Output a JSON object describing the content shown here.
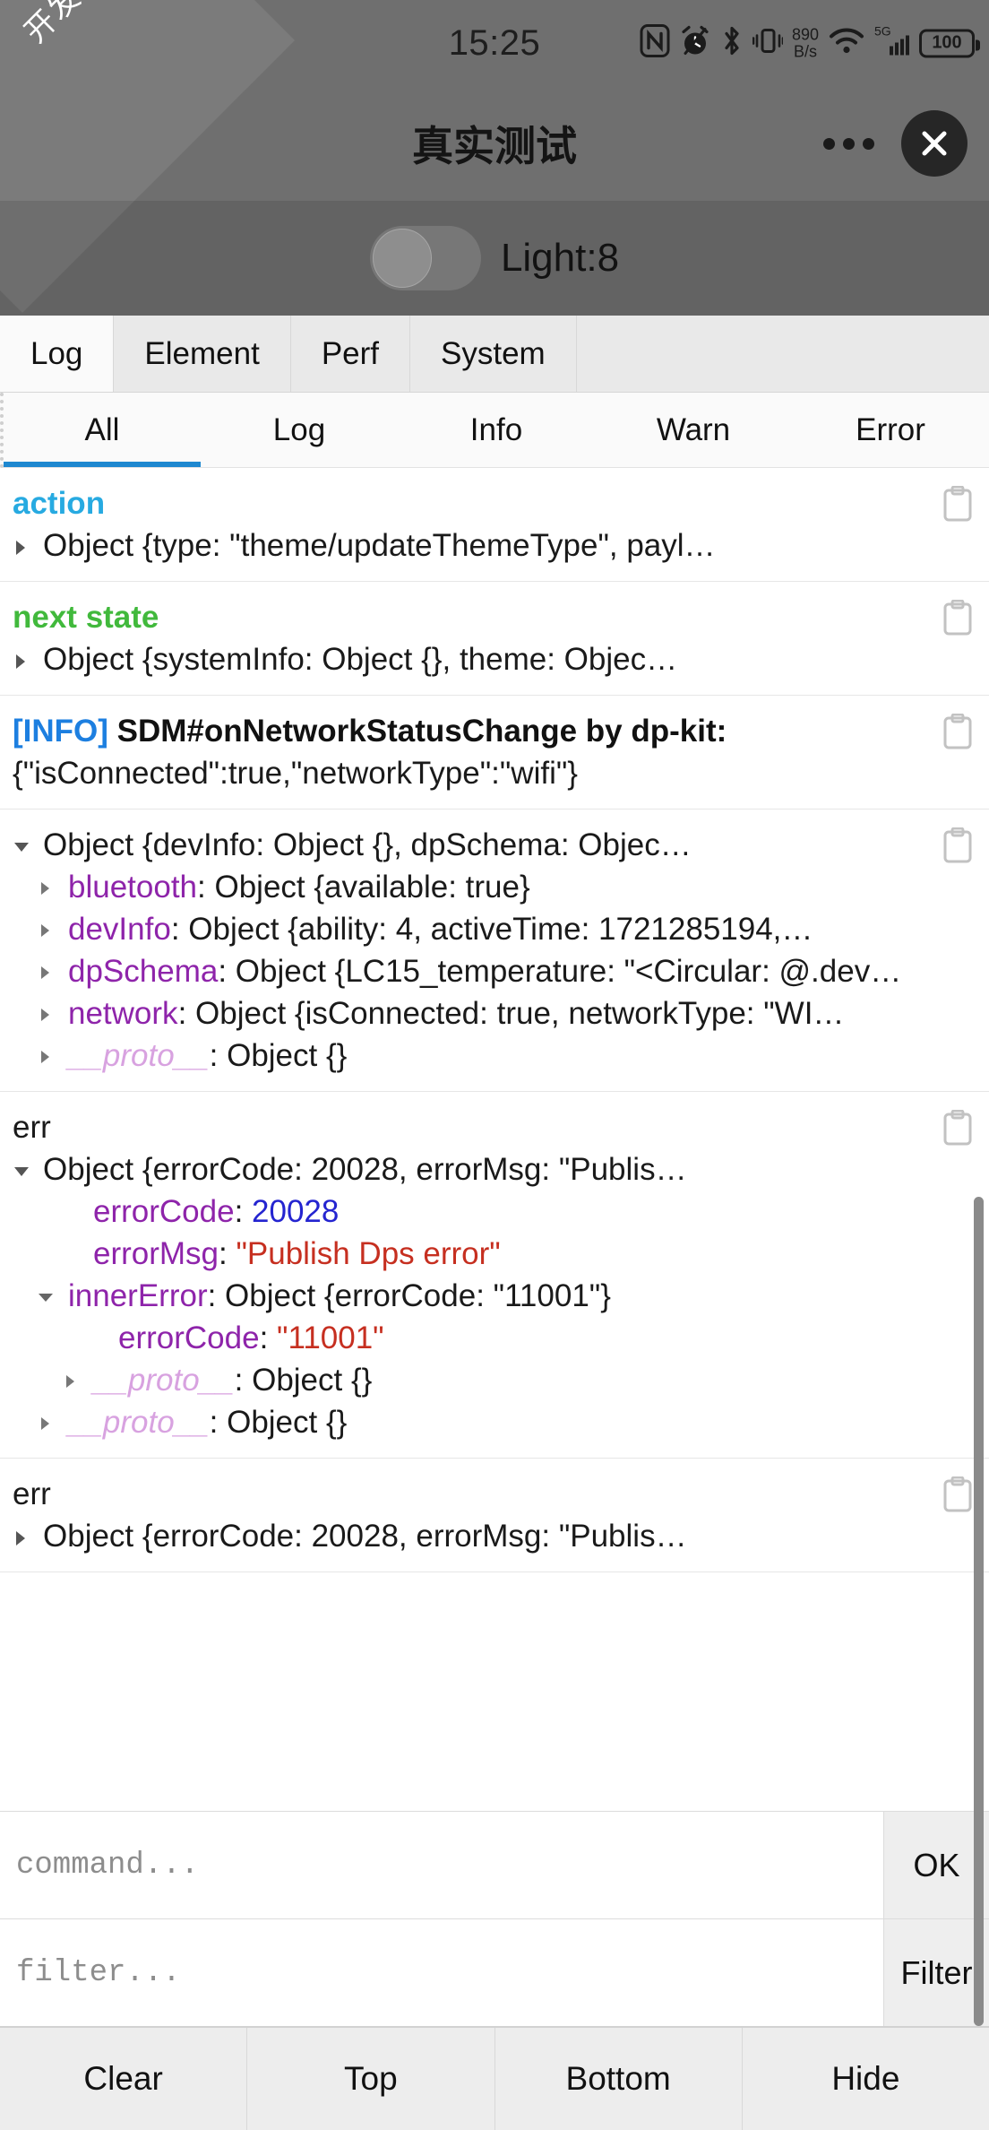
{
  "status_bar": {
    "clock": "15:25",
    "net_speed_value": "890",
    "net_speed_unit": "B/s",
    "cellular_label": "5G",
    "battery_level": "100",
    "icons": [
      "nfc-icon",
      "alarm-muted-icon",
      "bluetooth-icon",
      "vibrate-icon",
      "network-speed-icon",
      "wifi-icon",
      "cellular-signal-icon",
      "battery-icon"
    ]
  },
  "header": {
    "dev_badge": "开发版",
    "title": "真实测试",
    "more_icon": "more-dots-icon",
    "close_icon": "close-icon"
  },
  "device_control": {
    "switch_state": "off",
    "label": "Light:8"
  },
  "panel_tabs": [
    {
      "label": "Log",
      "active": true
    },
    {
      "label": "Element",
      "active": false
    },
    {
      "label": "Perf",
      "active": false
    },
    {
      "label": "System",
      "active": false
    }
  ],
  "level_tabs": [
    {
      "label": "All",
      "active": true
    },
    {
      "label": "Log",
      "active": false
    },
    {
      "label": "Info",
      "active": false
    },
    {
      "label": "Warn",
      "active": false
    },
    {
      "label": "Error",
      "active": false
    }
  ],
  "log_entries": [
    {
      "tag": "action",
      "tag_color": "#27aae1",
      "summary": "Object {type: \"theme/updateThemeType\", payl…",
      "expanded": false
    },
    {
      "tag": "next state",
      "tag_color": "#41b93c",
      "summary": "Object {systemInfo: Object {}, theme: Objec…",
      "expanded": false
    },
    {
      "level_tag": "[INFO]",
      "message": "SDM#onNetworkStatusChange by dp-kit:",
      "payload": "{\"isConnected\":true,\"networkType\":\"wifi\"}"
    },
    {
      "summary": "Object {devInfo: Object {}, dpSchema: Objec…",
      "expanded": true,
      "children": [
        {
          "key": "bluetooth",
          "rest": ": Object {available: true}",
          "indent": 1,
          "expandable": true
        },
        {
          "key": "devInfo",
          "rest": ": Object {ability: 4, activeTime: 1721285194,…",
          "indent": 1,
          "expandable": true
        },
        {
          "key": "dpSchema",
          "rest": ": Object {LC15_temperature: \"<Circular: @.dev…",
          "indent": 1,
          "expandable": true
        },
        {
          "key": "network",
          "rest": ": Object {isConnected: true, networkType: \"WI…",
          "indent": 1,
          "expandable": true
        },
        {
          "key": "__proto__",
          "proto": true,
          "rest": ": Object {}",
          "indent": 1,
          "expandable": true
        }
      ]
    },
    {
      "tag": "err",
      "tag_color": "#1a1a1a",
      "summary": "Object {errorCode: 20028, errorMsg: \"Publis…",
      "expanded": true,
      "children": [
        {
          "key": "errorCode",
          "rest": ": ",
          "value": "20028",
          "value_type": "number",
          "indent": 2,
          "expandable": false
        },
        {
          "key": "errorMsg",
          "rest": ": ",
          "value": "\"Publish Dps error\"",
          "value_type": "string",
          "indent": 2,
          "expandable": false
        },
        {
          "key": "innerError",
          "rest": ": Object {errorCode: \"11001\"}",
          "indent": 1,
          "expandable": true,
          "open": true
        },
        {
          "key": "errorCode",
          "rest": ": ",
          "value": "\"11001\"",
          "value_type": "string",
          "indent": 3,
          "expandable": false
        },
        {
          "key": "__proto__",
          "proto": true,
          "rest": ": Object {}",
          "indent": 2,
          "expandable": true
        },
        {
          "key": "__proto__",
          "proto": true,
          "rest": ": Object {}",
          "indent": 1,
          "expandable": true
        }
      ]
    },
    {
      "tag": "err",
      "tag_color": "#1a1a1a",
      "summary": "Object {errorCode: 20028, errorMsg: \"Publis…",
      "expanded": false
    }
  ],
  "copy_icon_name": "copy-clipboard-icon",
  "command_input": {
    "value": "",
    "placeholder": "command...",
    "button": "OK"
  },
  "filter_input": {
    "value": "",
    "placeholder": "filter...",
    "button": "Filter"
  },
  "action_bar": [
    {
      "label": "Clear"
    },
    {
      "label": "Top"
    },
    {
      "label": "Bottom"
    },
    {
      "label": "Hide"
    }
  ],
  "colors": {
    "accent_blue": "#1e88d0",
    "tag_action": "#27aae1",
    "tag_state": "#41b93c",
    "prop_purple": "#8e24aa",
    "value_number": "#2424d0",
    "value_string": "#c62f20",
    "header_grey": "#6f6f6f"
  }
}
